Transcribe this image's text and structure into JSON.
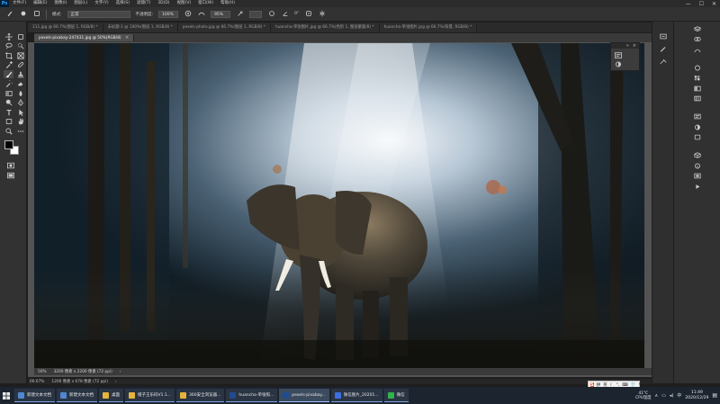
{
  "app": {
    "logo": "Ps"
  },
  "menu": [
    "文件(F)",
    "编辑(E)",
    "图像(I)",
    "图层(L)",
    "文字(Y)",
    "选择(S)",
    "滤镜(T)",
    "3D(D)",
    "视图(V)",
    "窗口(W)",
    "帮助(H)"
  ],
  "window_controls": {
    "minimize": "—",
    "maximize": "☐",
    "close": "✕"
  },
  "options": {
    "mode_label": "模式:",
    "mode_value": "正常",
    "opacity_label": "不透明度:",
    "opacity_value": "100%",
    "flow_value": "95%",
    "angle_value": "0°"
  },
  "doc_tabs": [
    "111.jpg @ 66.7%(图层 1, RGB/8) *",
    "未标题-1 @ 100%(图层 1, RGB/8) *",
    "pexels-photo.jpg @ 66.7%(图层 1, RGB/8) *",
    "huancha-单张图片.jpg @ 66.7%(色阶 1, 图层蒙版/8) *",
    "huancha-单张图片.jpg @ 66.7%(背景, RGB/8) *"
  ],
  "active_tab": {
    "label": "pexels-pixabay-247431.jpg @ 50%(RGB/8)",
    "close": "×"
  },
  "doc_status": {
    "zoom": "50%",
    "size": "3200 像素 x 2200 像素 (72 ppi)"
  },
  "app_status": {
    "zoom": "66.67%",
    "size": "1206 像素 x 678 像素 (72 ppi)"
  },
  "taskbar": {
    "items": [
      {
        "label": "新建文本文档",
        "color": "#4f87d1"
      },
      {
        "label": "新建文本文档",
        "color": "#4f87d1"
      },
      {
        "label": "桌面",
        "color": "#e6b43c"
      },
      {
        "label": "橙子王乐码V1.1...",
        "color": "#e6b43c"
      },
      {
        "label": "360安全浏览器...",
        "color": "#e6b43c"
      },
      {
        "label": "huancha-单张照...",
        "color": "#1f4b8f"
      },
      {
        "label": "pexels-pixabay...",
        "color": "#1f4b8f"
      },
      {
        "label": "微信图片_20201...",
        "color": "#3d6fe0"
      },
      {
        "label": "微信",
        "color": "#2fb34a"
      }
    ],
    "active_index": 6,
    "ime_chars": [
      "拼",
      "英"
    ],
    "cpu_temp": "41°C",
    "cpu_label": "CPU温度",
    "time": "11:49",
    "date": "2020/12/29"
  }
}
